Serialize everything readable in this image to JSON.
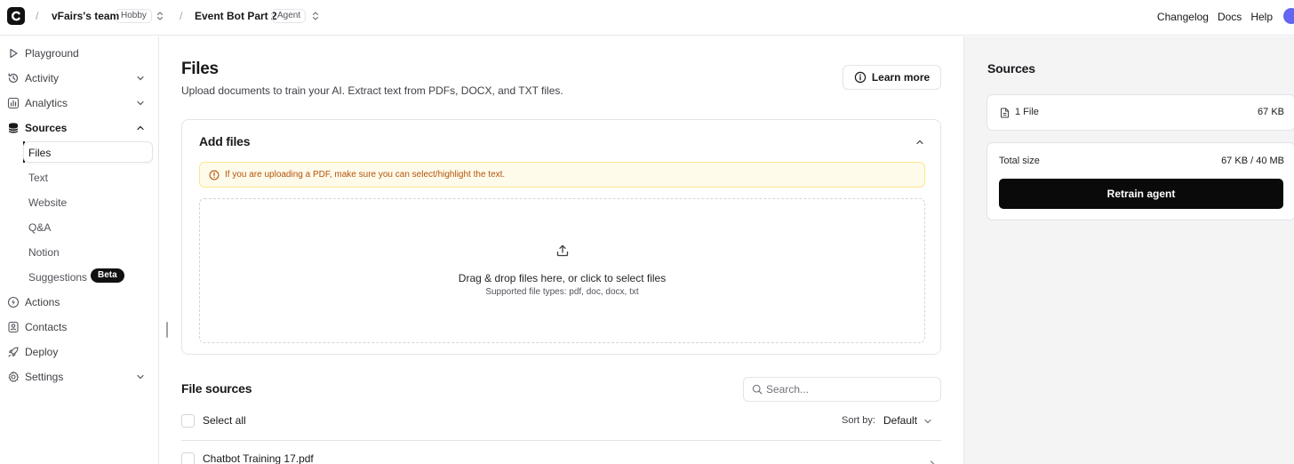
{
  "header": {
    "team_name": "vFairs's team",
    "team_plan": "Hobby",
    "agent_name": "Event Bot Part 2",
    "agent_badge": "Agent",
    "links": [
      "Changelog",
      "Docs",
      "Help"
    ]
  },
  "sidebar": {
    "items": [
      {
        "label": "Playground",
        "icon": "play-icon"
      },
      {
        "label": "Activity",
        "icon": "history-icon"
      },
      {
        "label": "Analytics",
        "icon": "bar-chart-icon"
      },
      {
        "label": "Sources",
        "icon": "database-icon"
      },
      {
        "label": "Actions",
        "icon": "bolt-icon"
      },
      {
        "label": "Contacts",
        "icon": "contact-icon"
      },
      {
        "label": "Deploy",
        "icon": "rocket-icon"
      },
      {
        "label": "Settings",
        "icon": "gear-icon"
      }
    ],
    "sources_sub": [
      "Files",
      "Text",
      "Website",
      "Q&A",
      "Notion",
      "Suggestions"
    ],
    "beta_label": "Beta"
  },
  "main": {
    "title": "Files",
    "subtitle": "Upload documents to train your AI. Extract text from PDFs, DOCX, and TXT files.",
    "learn_more": "Learn more",
    "add_files": {
      "title": "Add files",
      "warning": "If you are uploading a PDF, make sure you can select/highlight the text.",
      "drop_main": "Drag & drop files here, or click to select files",
      "drop_sub": "Supported file types: pdf, doc, docx, txt"
    },
    "file_sources": {
      "title": "File sources",
      "search_placeholder": "Search...",
      "select_all": "Select all",
      "sort_label": "Sort by:",
      "sort_value": "Default",
      "files": [
        "Chatbot Training 17.pdf"
      ]
    }
  },
  "right_panel": {
    "title": "Sources",
    "file_count": "1 File",
    "file_size": "67 KB",
    "total_label": "Total size",
    "total_value": "67 KB / 40 MB",
    "retrain": "Retrain agent"
  },
  "colors": {
    "accent": "#0a0a0a",
    "warning_bg": "#fffbeb",
    "warning_text": "#b45309",
    "panel_bg": "#f4f4f5"
  }
}
